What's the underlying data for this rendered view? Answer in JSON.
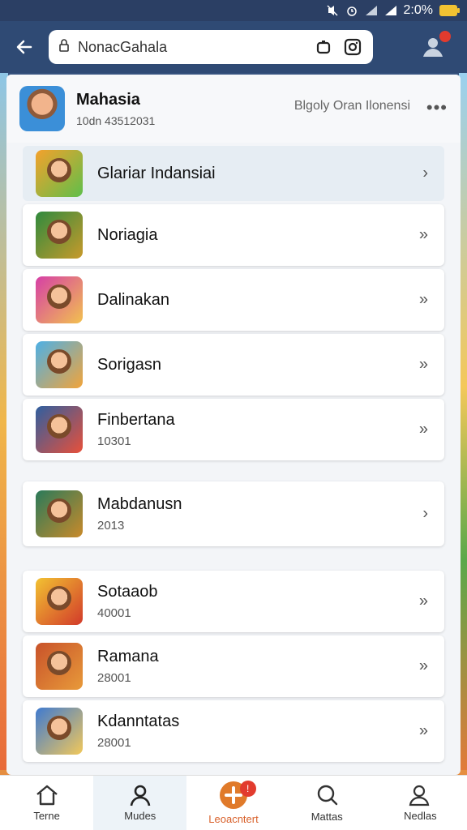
{
  "status_bar": {
    "time": "2:0%"
  },
  "header": {
    "search_text": "NonacGahala"
  },
  "top_item": {
    "title": "Mahasia",
    "subtitle": "10dn 43512031",
    "right_text": "Blgoly Oran Ilonensi",
    "more": "•••"
  },
  "rows": [
    {
      "name": "Glariar Indansiai",
      "num": ""
    },
    {
      "name": "Noriagia",
      "num": ""
    },
    {
      "name": "Dalinakan",
      "num": ""
    },
    {
      "name": "Sorigasn",
      "num": ""
    },
    {
      "name": "Finbertana",
      "num": "10301"
    },
    {
      "name": "Mabdanusn",
      "num": "2013"
    },
    {
      "name": "Sotaaob",
      "num": "40001"
    },
    {
      "name": "Ramana",
      "num": "28001"
    },
    {
      "name": "Kdanntatas",
      "num": "28001"
    }
  ],
  "bottom_nav": {
    "items": [
      {
        "label": "Terne"
      },
      {
        "label": "Mudes"
      },
      {
        "label": "Leoacntert"
      },
      {
        "label": "Mattas"
      },
      {
        "label": "Nedlas"
      }
    ],
    "badge": "!"
  },
  "colors": {
    "accent": "#e07a2a",
    "header": "#2f4a74",
    "badge": "#e23b2e"
  }
}
